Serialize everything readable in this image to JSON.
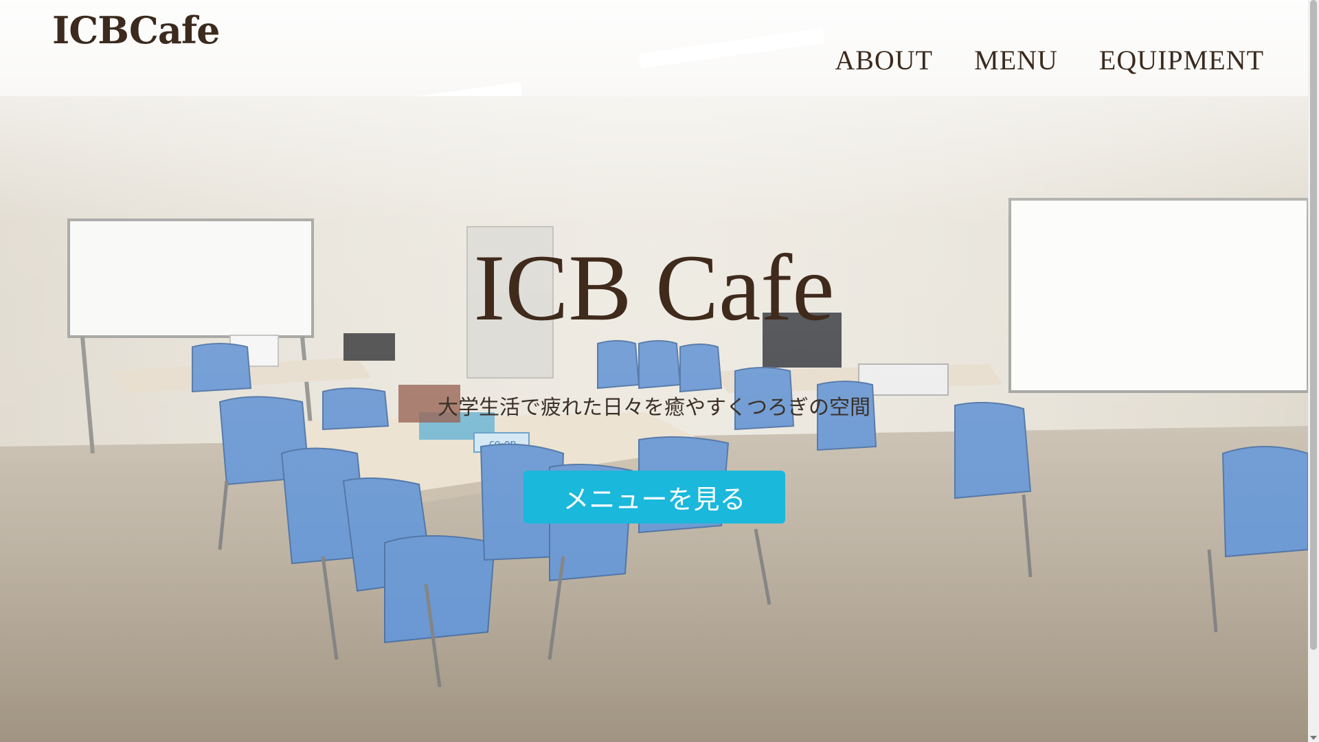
{
  "header": {
    "logo_text": "ICBCafe",
    "nav": [
      {
        "label": "ABOUT"
      },
      {
        "label": "MENU"
      },
      {
        "label": "EQUIPMENT"
      }
    ]
  },
  "hero": {
    "title": "ICB Cafe",
    "subtitle": "大学生活で疲れた日々を癒やすくつろぎの空間",
    "cta_label": "メニューを見る",
    "image_text": "co-op"
  },
  "colors": {
    "brand_text": "#3b2a1d",
    "cta_background": "#1ab8db",
    "cta_text": "#ffffff"
  }
}
